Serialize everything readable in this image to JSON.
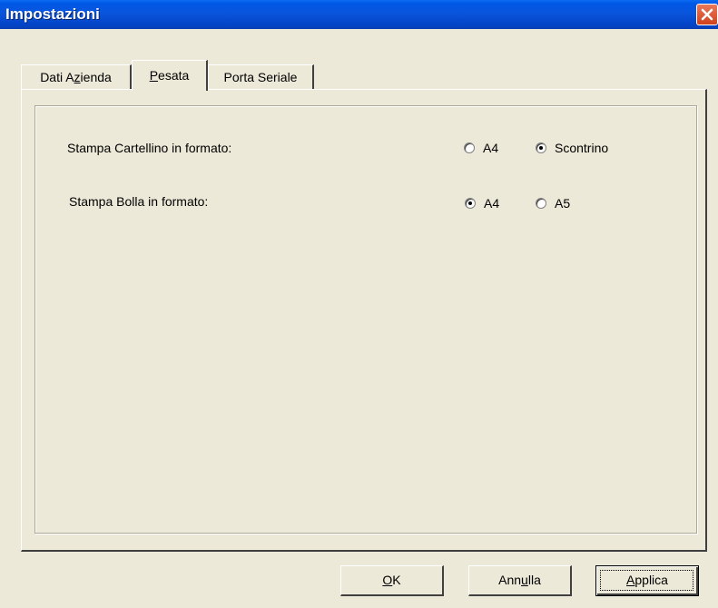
{
  "window": {
    "title": "Impostazioni",
    "close_icon": "close-icon"
  },
  "tabs": [
    {
      "label_pre": "Dati A",
      "label_mnemonic": "z",
      "label_post": "ienda",
      "active": false
    },
    {
      "label_pre": "",
      "label_mnemonic": "P",
      "label_post": "esata",
      "active": true
    },
    {
      "label_pre": "Porta Seriale",
      "label_mnemonic": "",
      "label_post": "",
      "active": false
    }
  ],
  "settings": {
    "cartellino": {
      "label": "Stampa Cartellino in formato:",
      "options": [
        {
          "label": "A4",
          "checked": false
        },
        {
          "label": "Scontrino",
          "checked": true
        }
      ]
    },
    "bolla": {
      "label": "Stampa Bolla in formato:",
      "options": [
        {
          "label": "A4",
          "checked": true
        },
        {
          "label": "A5",
          "checked": false
        }
      ]
    }
  },
  "buttons": {
    "ok": {
      "mnemonic": "O",
      "rest": "K"
    },
    "annulla": {
      "pre": "Ann",
      "mnemonic": "u",
      "post": "lla"
    },
    "applica": {
      "mnemonic": "A",
      "rest": "pplica"
    }
  },
  "colors": {
    "titlebar": "#0058e6",
    "dialog_bg": "#ece9d8",
    "close_button": "#d2421c"
  }
}
